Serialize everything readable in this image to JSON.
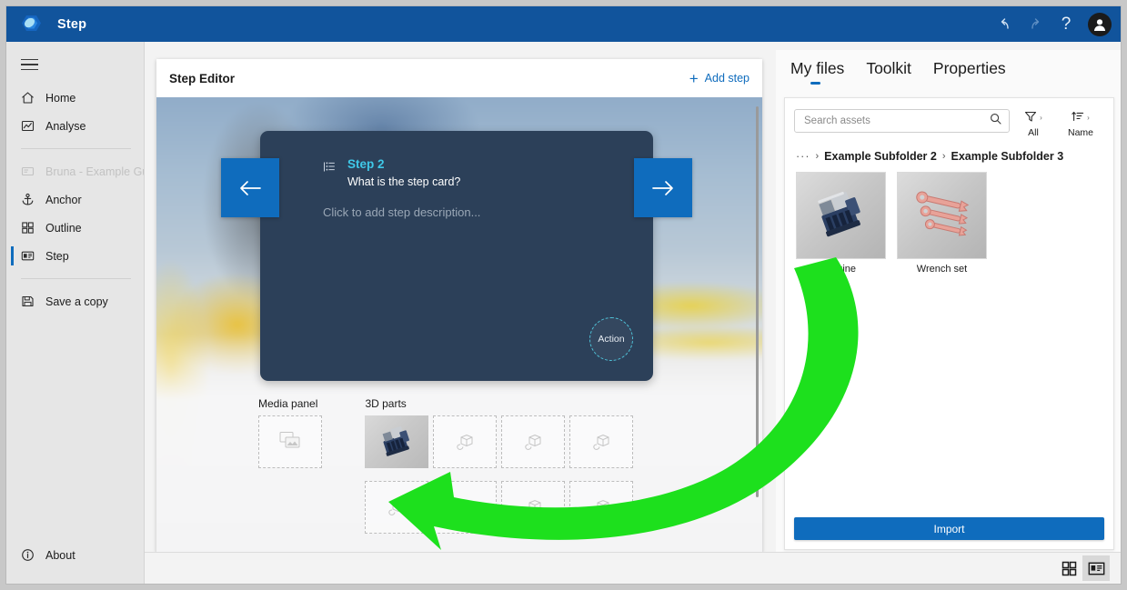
{
  "titlebar": {
    "app_name": "Step",
    "logo_icon": "step-logo-icon",
    "undo_icon": "undo-arrow-icon",
    "redo_icon": "redo-arrow-icon",
    "help_label": "?",
    "avatar_icon": "person-avatar-icon",
    "bg_color": "#11549c"
  },
  "sidebar": {
    "menu_icon": "hamburger-menu-icon",
    "items": [
      {
        "label": "Home",
        "icon": "home-icon",
        "state": "normal"
      },
      {
        "label": "Analyse",
        "icon": "analyse-chart-icon",
        "state": "normal"
      },
      {
        "label": "Bruna - Example Gui...",
        "icon": "guide-icon",
        "state": "disabled"
      },
      {
        "label": "Anchor",
        "icon": "anchor-icon",
        "state": "normal"
      },
      {
        "label": "Outline",
        "icon": "outline-grid-icon",
        "state": "normal"
      },
      {
        "label": "Step",
        "icon": "step-card-icon",
        "state": "selected"
      },
      {
        "label": "Save a copy",
        "icon": "save-disk-icon",
        "state": "normal"
      }
    ],
    "about": {
      "label": "About",
      "icon": "info-circle-icon"
    }
  },
  "editor": {
    "title": "Step Editor",
    "add_step_label": "Add step",
    "add_step_icon": "plus-icon",
    "step_card": {
      "list_icon": "bullet-list-icon",
      "step_label": "Step 2",
      "step_label_color": "#3fc8e8",
      "question": "What is the step card?",
      "description_placeholder": "Click to add step description...",
      "prev_icon": "arrow-left-icon",
      "next_icon": "arrow-right-icon",
      "action_label": "Action",
      "card_color": "#2c4059",
      "accent_color": "#0f6cbd"
    },
    "media_panel": {
      "title": "Media panel",
      "empty_icon": "media-images-icon",
      "slots": [
        {
          "filled": false
        }
      ]
    },
    "parts_panel": {
      "title": "3D parts",
      "empty_icon": "cube-3d-icon",
      "slots": [
        {
          "filled": true,
          "thumb": "engine-thumbnail"
        },
        {
          "filled": false
        },
        {
          "filled": false
        },
        {
          "filled": false
        },
        {
          "filled": false
        },
        {
          "filled": false
        },
        {
          "filled": false
        },
        {
          "filled": false
        }
      ]
    }
  },
  "right_panel": {
    "tabs": [
      {
        "label": "My files",
        "active": true
      },
      {
        "label": "Toolkit",
        "active": false
      },
      {
        "label": "Properties",
        "active": false
      }
    ],
    "search": {
      "placeholder": "Search assets",
      "value": "",
      "icon": "search-icon"
    },
    "filter_button": {
      "label": "All",
      "icon": "filter-funnel-icon",
      "chevron": "›"
    },
    "sort_button": {
      "label": "Name",
      "icon": "sort-ascending-icon",
      "chevron": "›"
    },
    "breadcrumb": {
      "overflow": "···",
      "separator": "›",
      "items": [
        "Example Subfolder 2",
        "Example Subfolder 3"
      ]
    },
    "assets": [
      {
        "name": "engine",
        "thumb": "engine-model-thumbnail"
      },
      {
        "name": "Wrench set",
        "thumb": "wrench-set-thumbnail"
      }
    ],
    "import_label": "Import"
  },
  "statusbar": {
    "grid_view": {
      "icon": "grid-view-icon",
      "active": false
    },
    "card_view": {
      "icon": "card-view-icon",
      "active": true
    }
  },
  "annotation": {
    "arrow_color": "#1de01d",
    "description": "curved-arrow-from-engine-asset-to-3d-parts-slot"
  }
}
